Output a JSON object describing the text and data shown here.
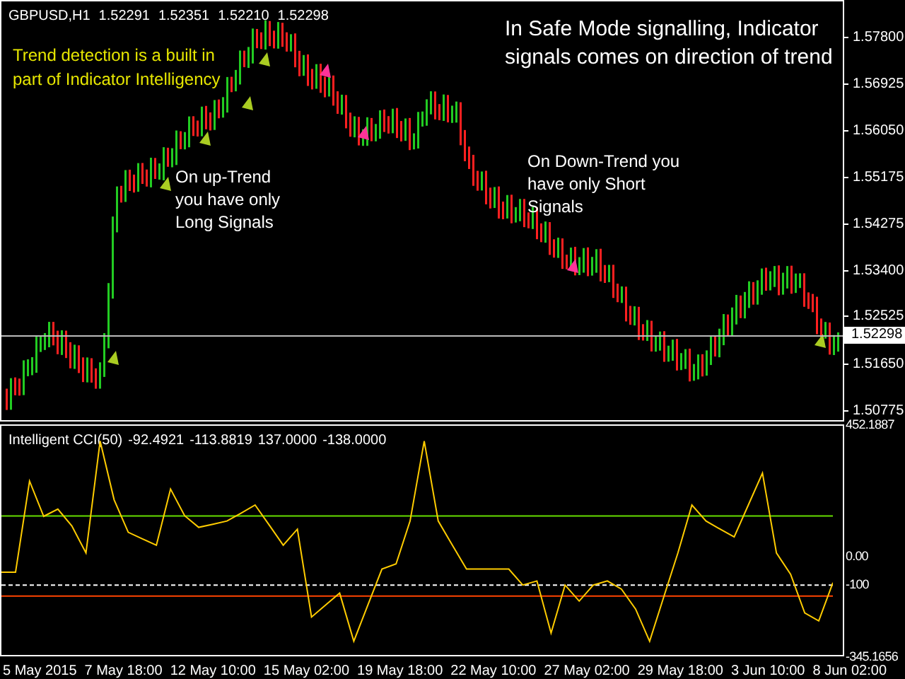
{
  "main_chart": {
    "symbol": "GBPUSD,H1",
    "ohlc": [
      "1.52291",
      "1.52351",
      "1.52210",
      "1.52298"
    ],
    "notes": [
      {
        "kind": "highlight",
        "lines": [
          "Trend detection is a built in",
          "part of Indicator Intelligency"
        ]
      },
      {
        "kind": "large",
        "lines": [
          "In Safe Mode signalling, Indicator",
          "signals comes on direction of trend"
        ]
      },
      {
        "kind": "plain",
        "lines": [
          "On up-Trend",
          "you have only",
          "Long Signals"
        ]
      },
      {
        "kind": "plain",
        "lines": [
          "On Down-Trend you",
          "have only Short",
          "Signals"
        ]
      }
    ],
    "price_axis": [
      "1.57800",
      "1.56925",
      "1.56050",
      "1.55175",
      "1.54275",
      "1.53400",
      "1.52525",
      "1.51650",
      "1.50775"
    ],
    "current_price": "1.52298"
  },
  "indicator": {
    "name": "Intelligent CCI(50)",
    "values": [
      "-92.4921",
      "-113.8819",
      "137.0000",
      "-138.0000"
    ],
    "chart_data": {
      "type": "line",
      "ylim": [
        -345.1656,
        452.1887
      ],
      "yticks": [
        {
          "value": 452.1887,
          "label": "452.1887"
        },
        {
          "value": 0,
          "label": "0.00"
        },
        {
          "value": -100,
          "label": "-100"
        },
        {
          "value": -345.1656,
          "label": "-345.1656"
        }
      ],
      "series": [
        {
          "color": "#66dd00",
          "values": [
            137,
            137,
            137,
            137,
            137,
            137,
            137,
            137,
            137,
            137,
            137,
            137,
            137,
            137,
            137,
            137,
            137,
            137,
            137,
            137,
            137,
            137,
            137,
            137,
            137,
            137,
            137,
            137,
            137,
            137,
            137,
            137,
            137,
            137,
            137,
            137,
            137,
            137,
            137,
            137,
            137,
            137,
            137,
            137,
            137,
            137,
            137,
            137,
            137,
            137,
            137,
            137,
            137,
            137,
            137,
            137,
            137,
            137,
            137,
            137
          ]
        },
        {
          "color": "#ff4400",
          "values": [
            -138,
            -138,
            -138,
            -138,
            -138,
            -138,
            -138,
            -138,
            -138,
            -138,
            -138,
            -138,
            -138,
            -138,
            -138,
            -138,
            -138,
            -138,
            -138,
            -138,
            -138,
            -138,
            -138,
            -138,
            -138,
            -138,
            -138,
            -138,
            -138,
            -138,
            -138,
            -138,
            -138,
            -138,
            -138,
            -138,
            -138,
            -138,
            -138,
            -138,
            -138,
            -138,
            -138,
            -138,
            -138,
            -138,
            -138,
            -138,
            -138,
            -138,
            -138,
            -138,
            -138,
            -138,
            -138,
            -138,
            -138,
            -138,
            -138,
            -138
          ]
        },
        {
          "color": "#ffcc00",
          "values": [
            -56,
            -56,
            257,
            136,
            161,
            103,
            10,
            395,
            193,
            81,
            59,
            37,
            230,
            138,
            98,
            109,
            120,
            147,
            175,
            106,
            37,
            92,
            -210,
            -169,
            -128,
            -293,
            -169,
            -45,
            -27,
            120,
            395,
            120,
            37,
            -45,
            -45,
            -45,
            -45,
            -100,
            -86,
            -265,
            -100,
            -155,
            -100,
            -86,
            -114,
            -183,
            -293,
            -141,
            10,
            175,
            120,
            92,
            65,
            175,
            285,
            10,
            -63,
            -196,
            -223,
            -92
          ]
        }
      ]
    }
  },
  "time_axis": [
    "5 May 2015",
    "7 May 18:00",
    "12 May 10:00",
    "15 May 02:00",
    "19 May 18:00",
    "22 May 10:00",
    "27 May 02:00",
    "29 May 18:00",
    "3 Jun 10:00",
    "8 Jun 02:00"
  ]
}
